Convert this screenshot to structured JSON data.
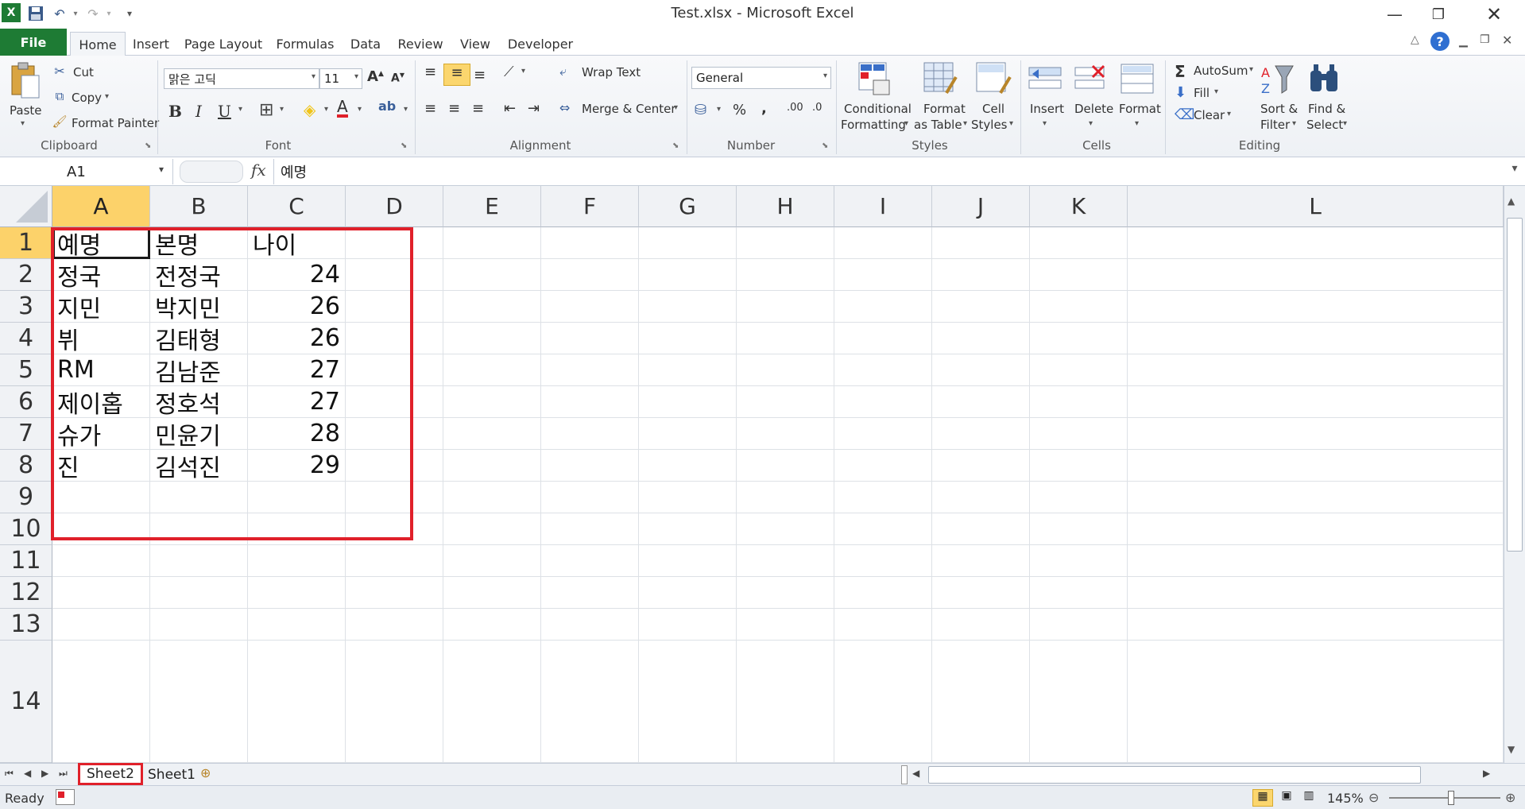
{
  "window": {
    "title": "Test.xlsx - Microsoft Excel"
  },
  "tabs": [
    "File",
    "Home",
    "Insert",
    "Page Layout",
    "Formulas",
    "Data",
    "Review",
    "View",
    "Developer"
  ],
  "ribbon": {
    "clipboard": {
      "paste": "Paste",
      "cut": "Cut",
      "copy": "Copy",
      "format_painter": "Format Painter",
      "label": "Clipboard"
    },
    "font": {
      "name": "맑은 고딕",
      "size": "11",
      "label": "Font"
    },
    "alignment": {
      "wrap": "Wrap Text",
      "merge": "Merge & Center",
      "label": "Alignment"
    },
    "number": {
      "format": "General",
      "label": "Number"
    },
    "styles": {
      "conditional1": "Conditional",
      "conditional2": "Formatting",
      "format_table1": "Format",
      "format_table2": "as Table",
      "cell_styles1": "Cell",
      "cell_styles2": "Styles",
      "label": "Styles"
    },
    "cells": {
      "insert": "Insert",
      "delete": "Delete",
      "format": "Format",
      "label": "Cells"
    },
    "editing": {
      "autosum": "AutoSum",
      "fill": "Fill",
      "clear": "Clear",
      "sort1": "Sort &",
      "sort2": "Filter",
      "find1": "Find &",
      "find2": "Select",
      "label": "Editing"
    }
  },
  "formula_bar": {
    "name_box": "A1",
    "fx": "fx",
    "content": "예명"
  },
  "columns": [
    "A",
    "B",
    "C",
    "D",
    "E",
    "F",
    "G",
    "H",
    "I",
    "J",
    "K",
    "L"
  ],
  "rows": [
    "1",
    "2",
    "3",
    "4",
    "5",
    "6",
    "7",
    "8",
    "9",
    "10",
    "11",
    "12",
    "13",
    "14"
  ],
  "table": [
    [
      "예명",
      "본명",
      "나이"
    ],
    [
      "정국",
      "전정국",
      "24"
    ],
    [
      "지민",
      "박지민",
      "26"
    ],
    [
      "뷔",
      "김태형",
      "26"
    ],
    [
      "RM",
      "김남준",
      "27"
    ],
    [
      "제이홉",
      "정호석",
      "27"
    ],
    [
      "슈가",
      "민윤기",
      "28"
    ],
    [
      "진",
      "김석진",
      "29"
    ]
  ],
  "sheets": [
    "Sheet2",
    "Sheet1"
  ],
  "status": {
    "ready": "Ready",
    "zoom": "145%"
  },
  "colors": {
    "file_tab": "#1e7b34",
    "selection_header": "#fcd26a",
    "highlight_box": "#e0202a"
  }
}
